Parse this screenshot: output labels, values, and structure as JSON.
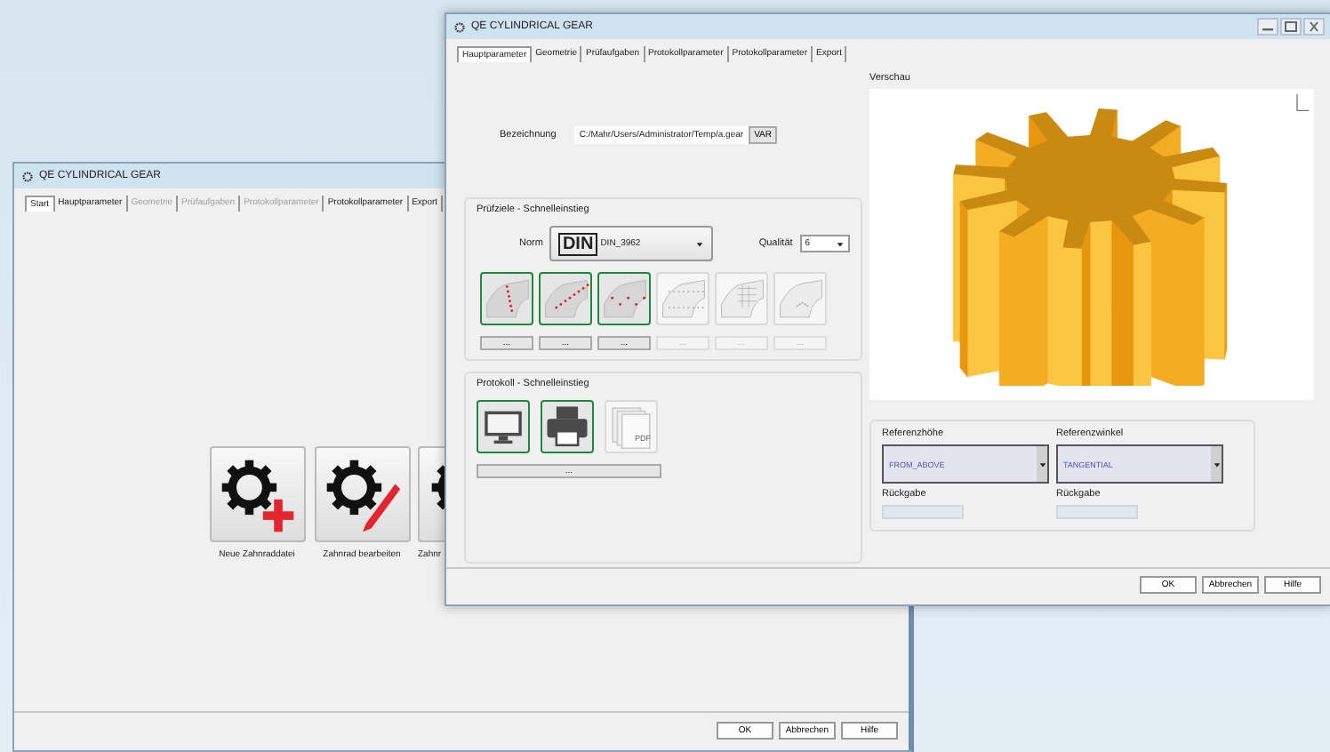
{
  "back_window": {
    "title": "QE CYLINDRICAL GEAR",
    "tabs": [
      {
        "label": "Start",
        "selected": true,
        "disabled": false
      },
      {
        "label": "Hauptparameter",
        "selected": false,
        "disabled": false
      },
      {
        "label": "Geometrie",
        "selected": false,
        "disabled": true
      },
      {
        "label": "Prüfaufgaben",
        "selected": false,
        "disabled": true
      },
      {
        "label": "Protokollparameter",
        "selected": false,
        "disabled": true
      },
      {
        "label": "Protokollparameter",
        "selected": false,
        "disabled": false
      },
      {
        "label": "Export",
        "selected": false,
        "disabled": false
      }
    ],
    "actions": [
      {
        "label": "Neue Zahnraddatei",
        "kind": "new"
      },
      {
        "label": "Zahnrad bearbeiten",
        "kind": "edit"
      },
      {
        "label": "Zahnr",
        "kind": "plain"
      }
    ],
    "buttons": [
      "OK",
      "Abbrechen",
      "Hilfe"
    ]
  },
  "front_window": {
    "title": "QE CYLINDRICAL GEAR",
    "tabs": [
      {
        "label": "Hauptparameter",
        "selected": true,
        "disabled": false
      },
      {
        "label": "Geometrie",
        "selected": false,
        "disabled": false
      },
      {
        "label": "Prüfaufgaben",
        "selected": false,
        "disabled": false
      },
      {
        "label": "Protokollparameter",
        "selected": false,
        "disabled": false
      },
      {
        "label": "Protokollparameter",
        "selected": false,
        "disabled": false
      },
      {
        "label": "Export",
        "selected": false,
        "disabled": false
      }
    ],
    "bezeichnung": {
      "label": "Bezeichnung",
      "value": "C:/Mahr/Users/Administrator/Temp/a.gear",
      "button": "VAR"
    },
    "pruefziele": {
      "title": "Prüfziele - Schnelleinstieg",
      "norm_label": "Norm",
      "norm_logo": "DIN",
      "norm_value": "DIN_3962",
      "quality_label": "Qualität",
      "quality_value": "6",
      "targets": [
        {
          "kind": "profile",
          "selected": true,
          "disabled": false,
          "button": "..."
        },
        {
          "kind": "lead",
          "selected": true,
          "disabled": false,
          "button": "..."
        },
        {
          "kind": "pitch",
          "selected": true,
          "disabled": false,
          "button": "..."
        },
        {
          "kind": "runout",
          "selected": false,
          "disabled": true,
          "button": "..."
        },
        {
          "kind": "surface",
          "selected": false,
          "disabled": true,
          "button": "..."
        },
        {
          "kind": "thickness",
          "selected": false,
          "disabled": true,
          "button": "..."
        }
      ]
    },
    "protokoll": {
      "title": "Protokoll - Schnelleinstieg",
      "outputs": [
        {
          "kind": "screen",
          "selected": true,
          "disabled": false
        },
        {
          "kind": "printer",
          "selected": true,
          "disabled": false
        },
        {
          "kind": "pdf",
          "selected": false,
          "disabled": true,
          "label": "PDF"
        }
      ],
      "button": "..."
    },
    "preview": {
      "title": "Verschau"
    },
    "reference": [
      {
        "label": "Referenzhöhe",
        "value": "FROM_ABOVE",
        "return_label": "Rückgabe"
      },
      {
        "label": "Referenzwinkel",
        "value": "TANGENTIAL",
        "return_label": "Rückgabe"
      }
    ],
    "buttons": [
      "OK",
      "Abbrechen",
      "Hilfe"
    ]
  }
}
